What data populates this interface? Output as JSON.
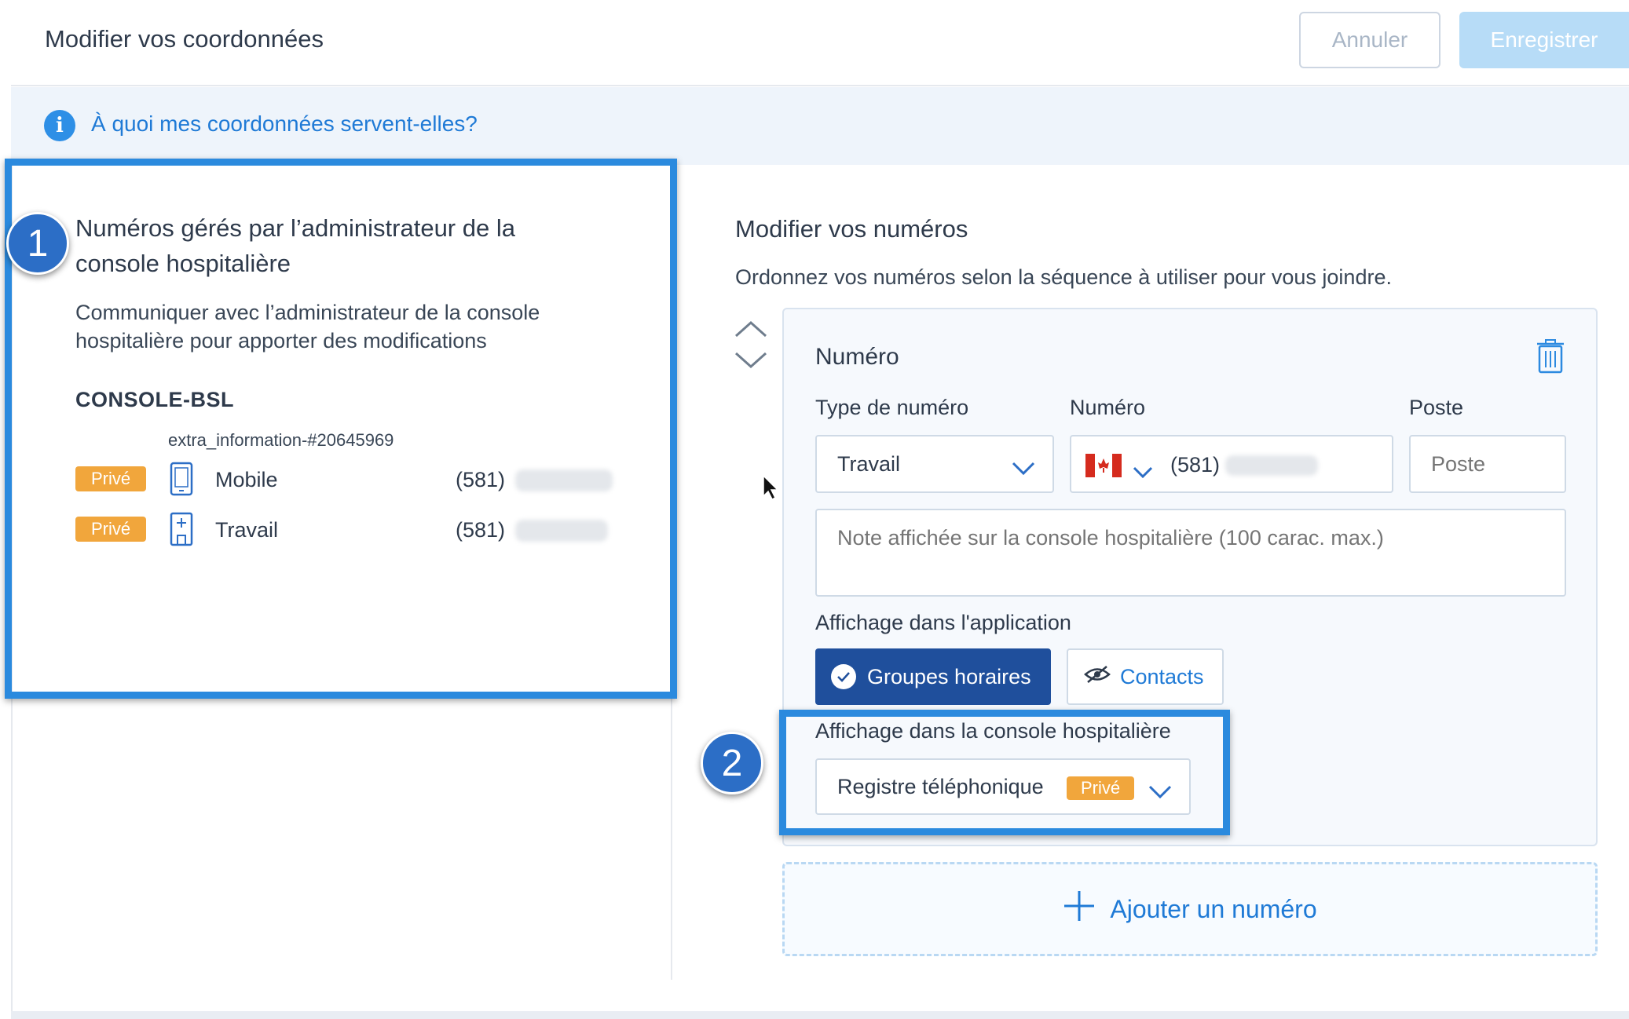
{
  "header": {
    "title": "Modifier vos coordonnées",
    "cancel_label": "Annuler",
    "save_label": "Enregistrer"
  },
  "banner": {
    "info_icon": "i",
    "link_text": "À quoi mes coordonnées servent-elles?"
  },
  "left_panel": {
    "title": "Numéros gérés par l’administrateur de la console hospitalière",
    "description": "Communiquer avec l’administrateur de la console hospitalière pour apporter des modifications",
    "console_name": "CONSOLE-BSL",
    "extra_information": "extra_information-#20645969",
    "numbers": [
      {
        "badge": "Privé",
        "icon": "mobile-phone-icon",
        "type": "Mobile",
        "area_code": "(581)"
      },
      {
        "badge": "Privé",
        "icon": "work-phone-icon",
        "type": "Travail",
        "area_code": "(581)"
      }
    ]
  },
  "right_panel": {
    "title": "Modifier vos numéros",
    "description": "Ordonnez vos numéros selon la séquence à utiliser pour vous joindre.",
    "card": {
      "title": "Numéro",
      "type_label": "Type de numéro",
      "type_value": "Travail",
      "number_label": "Numéro",
      "number_value": "(581)",
      "country_flag": "canada-flag-icon",
      "extension_label": "Poste",
      "extension_placeholder": "Poste",
      "note_placeholder": "Note affichée sur la console hospitalière (100 carac. max.)",
      "app_display_label": "Affichage dans l'application",
      "app_display_options": [
        "Groupes horaires",
        "Contacts"
      ],
      "app_display_selected": "Groupes horaires",
      "console_display_label": "Affichage dans la console hospitalière",
      "console_display_value": "Registre téléphonique",
      "console_display_badge": "Privé"
    },
    "add_number_label": "Ajouter un numéro"
  },
  "callouts": [
    "1",
    "2"
  ],
  "colors": {
    "accent_blue": "#2b8ade",
    "link_blue": "#1f7ad6",
    "selected_segment": "#1f4f9c",
    "badge_orange": "#f1a63c",
    "save_disabled": "#b7dcf7"
  }
}
